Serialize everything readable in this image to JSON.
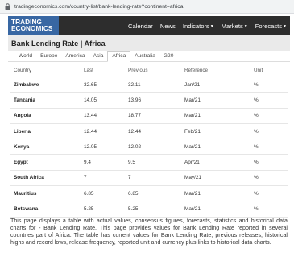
{
  "browser": {
    "url": "tradingeconomics.com/country-list/bank-lending-rate?continent=africa"
  },
  "logo": {
    "line1": "TRADING",
    "line2": "ECONOMICS"
  },
  "nav": [
    {
      "label": "Calendar",
      "dropdown": false
    },
    {
      "label": "News",
      "dropdown": false
    },
    {
      "label": "Indicators",
      "dropdown": true
    },
    {
      "label": "Markets",
      "dropdown": true
    },
    {
      "label": "Forecasts",
      "dropdown": true
    }
  ],
  "page": {
    "title": "Bank Lending Rate | Africa"
  },
  "tabs": [
    {
      "label": "World",
      "active": false
    },
    {
      "label": "Europe",
      "active": false
    },
    {
      "label": "America",
      "active": false
    },
    {
      "label": "Asia",
      "active": false
    },
    {
      "label": "Africa",
      "active": true
    },
    {
      "label": "Australia",
      "active": false
    },
    {
      "label": "G20",
      "active": false
    }
  ],
  "table": {
    "headers": [
      "Country",
      "Last",
      "Previous",
      "Reference",
      "Unit"
    ],
    "rows": [
      {
        "country": "Zimbabwe",
        "last": "32.65",
        "previous": "32.11",
        "reference": "Jan/21",
        "unit": "%"
      },
      {
        "country": "Tanzania",
        "last": "14.05",
        "previous": "13.96",
        "reference": "Mar/21",
        "unit": "%"
      },
      {
        "country": "Angola",
        "last": "13.44",
        "previous": "18.77",
        "reference": "Mar/21",
        "unit": "%"
      },
      {
        "country": "Liberia",
        "last": "12.44",
        "previous": "12.44",
        "reference": "Feb/21",
        "unit": "%"
      },
      {
        "country": "Kenya",
        "last": "12.05",
        "previous": "12.02",
        "reference": "Mar/21",
        "unit": "%"
      },
      {
        "country": "Egypt",
        "last": "9.4",
        "previous": "9.5",
        "reference": "Apr/21",
        "unit": "%"
      },
      {
        "country": "South Africa",
        "last": "7",
        "previous": "7",
        "reference": "May/21",
        "unit": "%"
      },
      {
        "country": "Mauritius",
        "last": "6.85",
        "previous": "6.85",
        "reference": "Mar/21",
        "unit": "%"
      },
      {
        "country": "Botswana",
        "last": "5.25",
        "previous": "5.25",
        "reference": "Mar/21",
        "unit": "%"
      }
    ]
  },
  "description": "This page displays a table with actual values, consensus figures, forecasts, statistics and historical data charts for - Bank Lending Rate. This page provides values for Bank Lending Rate reported in several countries part of Africa. The table has current values for Bank Lending Rate, previous releases, historical highs and record lows, release frequency, reported unit and currency plus links to historical data charts.",
  "colors": {
    "navbar": "#2d2d2d",
    "logo_bg": "#3867a3",
    "header_bg": "#eaeaea"
  }
}
